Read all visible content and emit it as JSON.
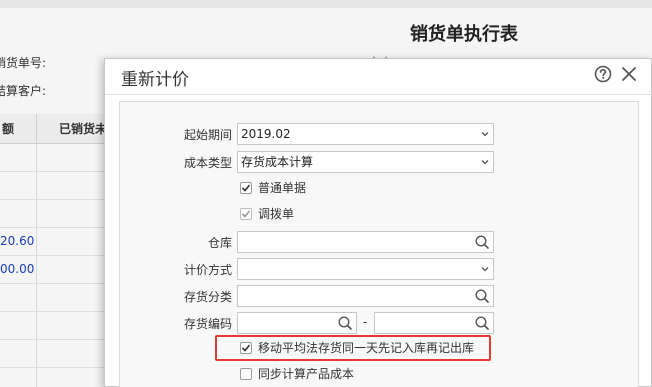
{
  "background": {
    "report_title": "销货单执行表",
    "label_order_no": "销货单号:",
    "label_customer": "结算客户:",
    "label_partial": "客户",
    "table_headers": [
      "额",
      "已销货未"
    ],
    "values": [
      "20.60",
      "00.00"
    ]
  },
  "dialog": {
    "title": "重新计价",
    "help_icon": "question-circle-icon",
    "close_icon": "close-icon",
    "form": {
      "start_period_label": "起始期间",
      "start_period_value": "2019.02",
      "cost_type_label": "成本类型",
      "cost_type_value": "存货成本计算",
      "normal_docs_label": "普通单据",
      "transfer_docs_label": "调拨单",
      "warehouse_label": "仓库",
      "warehouse_value": "",
      "valuation_method_label": "计价方式",
      "valuation_method_value": "",
      "inventory_category_label": "存货分类",
      "inventory_category_value": "",
      "inventory_code_label": "存货编码",
      "inventory_code_from": "",
      "inventory_code_to": "",
      "range_separator": "-",
      "moving_avg_option_label": "移动平均法存货同一天先记入库再记出库",
      "sync_cost_option_label": "同步计算产品成本"
    },
    "checkbox_states": {
      "normal_docs": true,
      "transfer_docs": true,
      "moving_avg_option": true,
      "sync_cost_option": false
    },
    "colors": {
      "highlight": "#e53935",
      "link_value": "#1a3cb8"
    }
  }
}
